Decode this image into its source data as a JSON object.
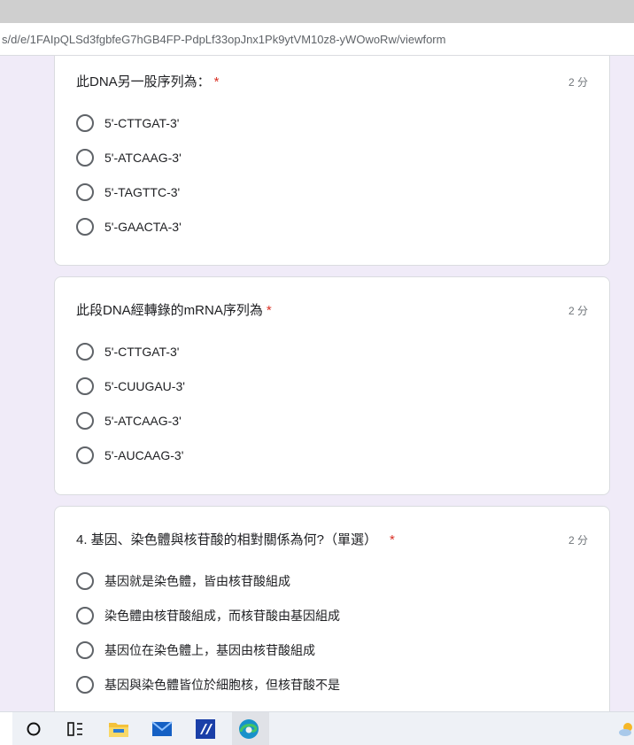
{
  "browser": {
    "url": "s/d/e/1FAIpQLSd3fgbfeG7hGB4FP-PdpLf33opJnx1Pk9ytVM10z8-yWOwoRw/viewform"
  },
  "questions": [
    {
      "title": "此DNA另一股序列為：",
      "required": "*",
      "points": "2 分",
      "options": [
        "5'-CTTGAT-3'",
        "5'-ATCAAG-3'",
        "5'-TAGTTC-3'",
        "5'-GAACTA-3'"
      ]
    },
    {
      "title": "此段DNA經轉錄的mRNA序列為",
      "required": "*",
      "points": "2 分",
      "options": [
        "5'-CTTGAT-3'",
        "5'-CUUGAU-3'",
        "5'-ATCAAG-3'",
        "5'-AUCAAG-3'"
      ]
    },
    {
      "title": "4. 基因、染色體與核苷酸的相對關係為何?（單選）",
      "required": "*",
      "points": "2 分",
      "options": [
        "基因就是染色體，皆由核苷酸組成",
        "染色體由核苷酸組成，而核苷酸由基因組成",
        "基因位在染色體上，基因由核苷酸組成",
        "基因與染色體皆位於細胞核，但核苷酸不是"
      ]
    }
  ],
  "taskbar": {
    "items": [
      "search-circle-icon",
      "task-view-icon",
      "file-explorer-icon",
      "mail-icon",
      "app-icon",
      "edge-browser-icon"
    ]
  }
}
